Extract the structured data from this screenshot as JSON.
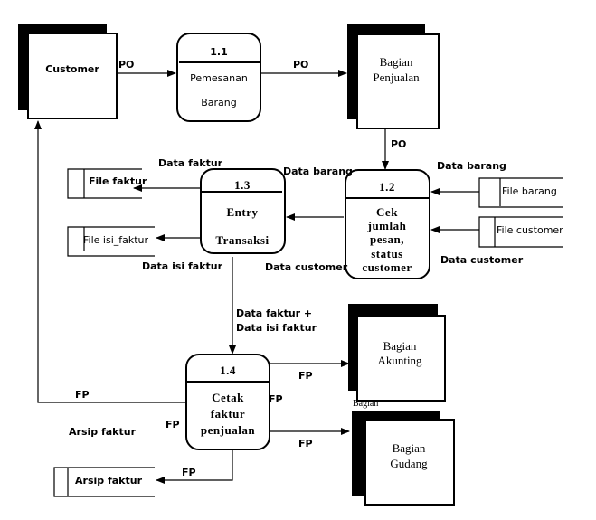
{
  "entities": {
    "customer": "Customer",
    "penjualan": [
      "Bagian",
      "Penjualan"
    ],
    "akunting": [
      "Bagian",
      "Akunting"
    ],
    "gudang": [
      "Bagian",
      "Gudang"
    ],
    "cropped_label": "Bagian"
  },
  "processes": {
    "p11": {
      "id": "1.1",
      "lines": [
        "Pemesanan",
        "Barang"
      ]
    },
    "p12": {
      "id": "1.2",
      "lines": [
        "Cek",
        "jumlah",
        "pesan,",
        "status",
        "customer"
      ]
    },
    "p13": {
      "id": "1.3",
      "lines": [
        "Entry",
        "Transaksi"
      ]
    },
    "p14": {
      "id": "1.4",
      "lines": [
        "Cetak",
        "faktur",
        "penjualan"
      ]
    }
  },
  "stores": {
    "file_faktur": "File faktur",
    "file_isi_faktur": "File isi_faktur",
    "file_barang": "File barang",
    "file_customer": "File customer",
    "arsip_faktur": "Arsip faktur"
  },
  "flows": {
    "po1": "PO",
    "po2": "PO",
    "po3": "PO",
    "data_barang_in": "Data barang",
    "data_customer_in": "Data customer",
    "data_barang_out": "Data barang",
    "data_customer_out": "Data customer",
    "data_faktur": "Data faktur",
    "data_isi_faktur": "Data isi  faktur",
    "combined": [
      "Data faktur +",
      "Data isi  faktur"
    ],
    "fp_customer": "FP",
    "fp_akunting": "FP",
    "fp_side": "FP",
    "fp_gudang": "FP",
    "fp_left": "FP",
    "arsip_label": "Arsip faktur",
    "fp_arsip": "FP"
  }
}
